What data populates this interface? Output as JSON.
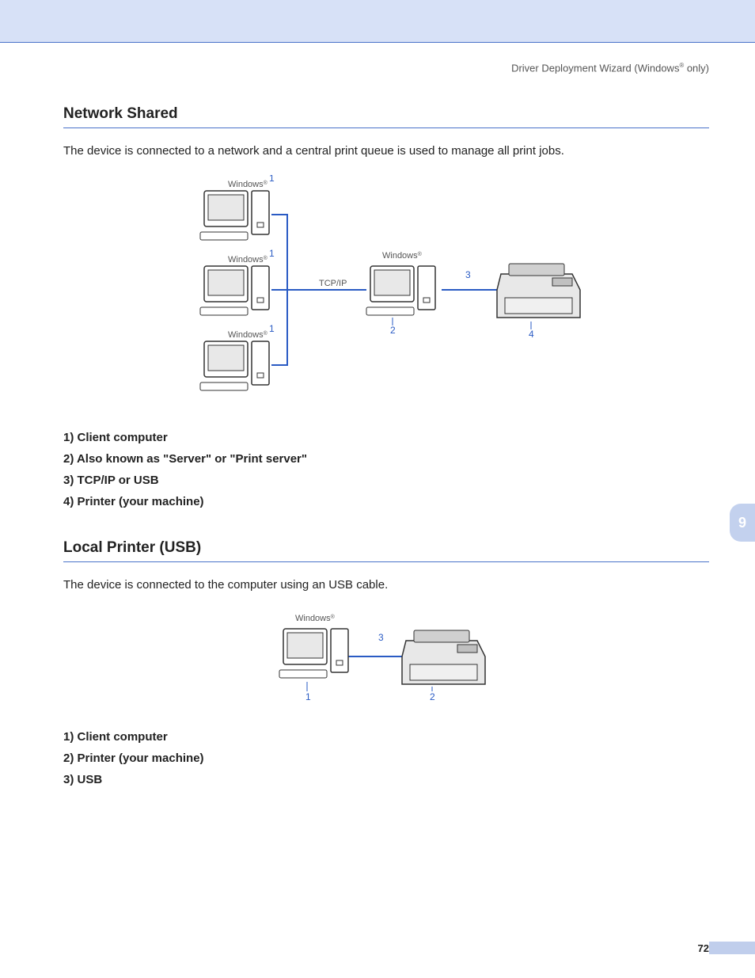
{
  "header": {
    "breadcrumb_prefix": "Driver Deployment Wizard (Windows",
    "breadcrumb_suffix": " only)"
  },
  "section1": {
    "title": "Network Shared",
    "desc": "The device is connected to a network and a central print queue is used to manage all print jobs.",
    "items": [
      "1) Client computer",
      "2) Also known as \"Server\" or \"Print server\"",
      "3) TCP/IP or USB",
      "4) Printer (your machine)"
    ],
    "diagram": {
      "windows": "Windows",
      "tcpip": "TCP/IP",
      "n1": "1",
      "n2": "2",
      "n3": "3",
      "n4": "4"
    }
  },
  "section2": {
    "title": "Local Printer (USB)",
    "desc": "The device is connected to the computer using an USB cable.",
    "items": [
      "1) Client computer",
      "2) Printer (your machine)",
      "3) USB"
    ],
    "diagram": {
      "windows": "Windows",
      "n1": "1",
      "n2": "2",
      "n3": "3"
    }
  },
  "chapter": "9",
  "page_number": "72"
}
